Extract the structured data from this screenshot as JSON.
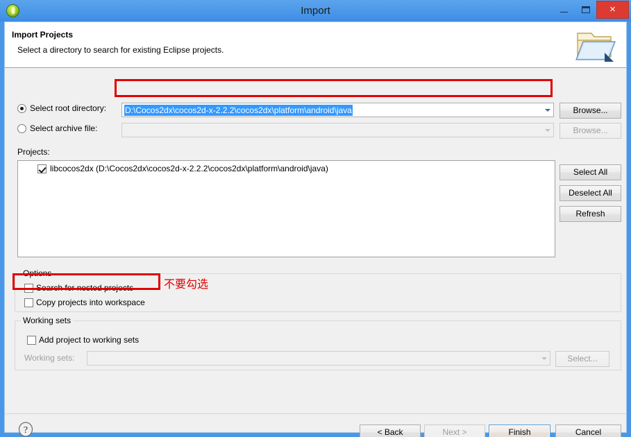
{
  "window": {
    "title": "Import",
    "app_icon": "eclipse-icon",
    "minimize_label": "–",
    "maximize_label": "□",
    "close_label": "×"
  },
  "header": {
    "title": "Import Projects",
    "description": "Select a directory to search for existing Eclipse projects.",
    "icon": "import-folder-icon"
  },
  "source": {
    "root_directory": {
      "radio_label": "Select root directory:",
      "selected": true,
      "value": "D:\\Cocos2dx\\cocos2d-x-2.2.2\\cocos2dx\\platform\\android\\java",
      "browse_label": "Browse..."
    },
    "archive_file": {
      "radio_label": "Select archive file:",
      "selected": false,
      "value": "",
      "browse_label": "Browse..."
    }
  },
  "projects": {
    "label": "Projects:",
    "items": [
      {
        "checked": true,
        "label": "libcocos2dx (D:\\Cocos2dx\\cocos2d-x-2.2.2\\cocos2dx\\platform\\android\\java)"
      }
    ],
    "buttons": {
      "select_all": "Select All",
      "deselect_all": "Deselect All",
      "refresh": "Refresh"
    }
  },
  "options": {
    "group_title": "Options",
    "search_nested": {
      "label": "Search for nested projects",
      "checked": false
    },
    "copy_projects": {
      "label": "Copy projects into workspace",
      "checked": false
    }
  },
  "working_sets": {
    "group_title": "Working sets",
    "add_project": {
      "label": "Add project to working sets",
      "checked": false
    },
    "field_label": "Working sets:",
    "field_value": "",
    "select_label": "Select..."
  },
  "annotations": {
    "chinese_note": "不要勾选",
    "highlight_color": "#e00000"
  },
  "footer": {
    "help": "?",
    "back": "< Back",
    "next": "Next >",
    "finish": "Finish",
    "cancel": "Cancel"
  }
}
